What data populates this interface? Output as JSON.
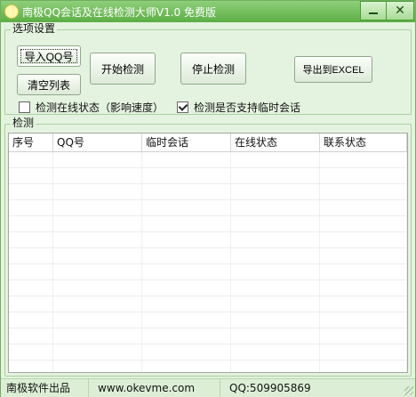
{
  "window": {
    "title": "南极QQ会话及在线检测大师V1.0 免费版",
    "minimize_glyph": "",
    "close_glyph": "✕"
  },
  "options": {
    "legend": "选项设置",
    "import_button": "导入QQ号",
    "clear_button": "清空列表",
    "start_button": "开始检测",
    "stop_button": "停止检测",
    "export_button": "导出到EXCEL",
    "check_online": {
      "label": "检测在线状态（影响速度）",
      "checked": false
    },
    "check_temp": {
      "label": "检测是否支持临时会话",
      "checked": true
    }
  },
  "detect": {
    "legend": "检测",
    "columns": [
      "序号",
      "QQ号",
      "临时会话",
      "在线状态",
      "联系状态"
    ],
    "rows": []
  },
  "status": {
    "left": "南极软件出品",
    "middle": "www.okevme.com",
    "right": "QQ:509905869"
  },
  "colors": {
    "title_bar": "#5cae45",
    "window_bg": "#e4f3df"
  }
}
